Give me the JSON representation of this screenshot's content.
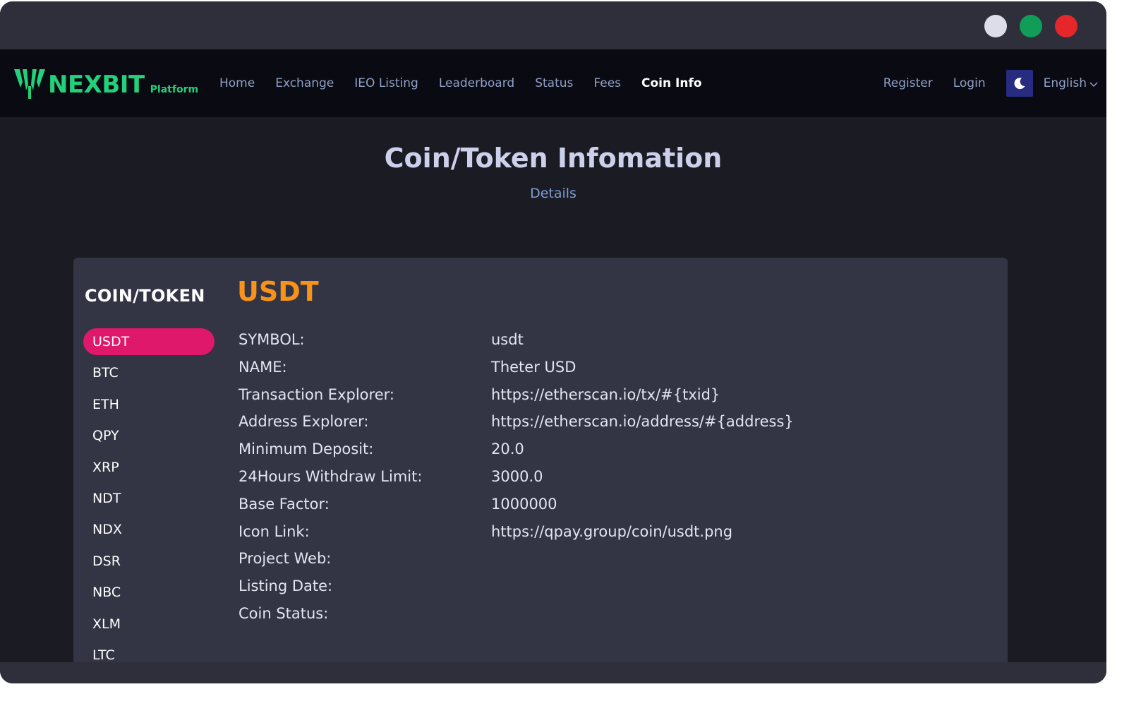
{
  "window": {
    "controls": [
      {
        "name": "minimize",
        "color": "#dcdde8"
      },
      {
        "name": "maximize",
        "color": "#0f9d58"
      },
      {
        "name": "close",
        "color": "#e5262b"
      }
    ]
  },
  "header": {
    "logo_text": "NEXBIT",
    "logo_sub": "Platform",
    "nav": [
      "Home",
      "Exchange",
      "IEO Listing",
      "Leaderboard",
      "Status",
      "Fees",
      "Coin Info"
    ],
    "active_nav": "Coin Info",
    "register": "Register",
    "login": "Login",
    "theme_icon": "moon-icon",
    "language": "English"
  },
  "hero": {
    "title": "Coin/Token Infomation",
    "subtitle": "Details"
  },
  "sidebar": {
    "title": "COIN/TOKEN",
    "coins": [
      "USDT",
      "BTC",
      "ETH",
      "QPY",
      "XRP",
      "NDT",
      "NDX",
      "DSR",
      "NBC",
      "XLM",
      "LTC"
    ],
    "selected": "USDT"
  },
  "detail": {
    "coin": "USDT",
    "rows": [
      {
        "label": "SYMBOL:",
        "value": "usdt"
      },
      {
        "label": "NAME:",
        "value": "Theter USD"
      },
      {
        "label": "Transaction Explorer:",
        "value": "https://etherscan.io/tx/#{txid}"
      },
      {
        "label": "Address Explorer:",
        "value": "https://etherscan.io/address/#{address}"
      },
      {
        "label": "Minimum Deposit:",
        "value": "20.0"
      },
      {
        "label": "24Hours Withdraw Limit:",
        "value": "3000.0"
      },
      {
        "label": "Base Factor:",
        "value": "1000000"
      },
      {
        "label": "Icon Link:",
        "value": "https://qpay.group/coin/usdt.png"
      },
      {
        "label": "Project Web:",
        "value": ""
      },
      {
        "label": "Listing Date:",
        "value": ""
      },
      {
        "label": "Coin Status:",
        "value": ""
      }
    ]
  },
  "colors": {
    "accent": "#e0186b",
    "coin_title": "#f7931a",
    "brand": "#22d17a"
  }
}
